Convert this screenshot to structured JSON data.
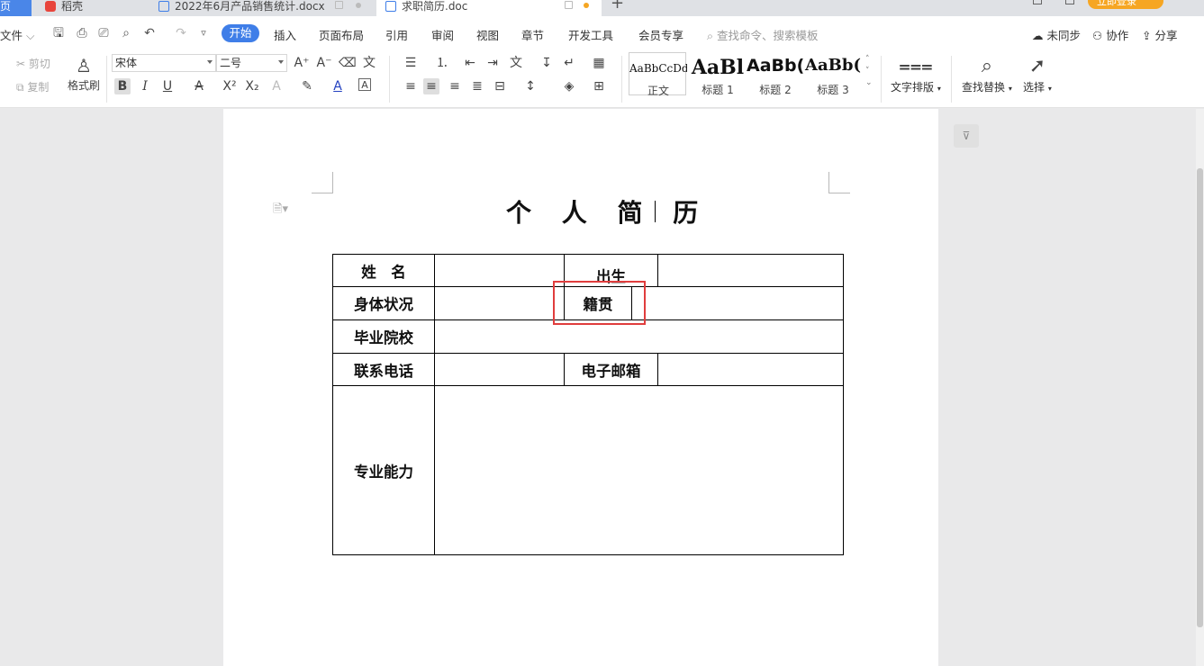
{
  "tabs": {
    "home": "页",
    "daoke": "稻壳",
    "sales_doc": "2022年6月产品销售统计.docx",
    "resume_doc": "求职简历.doc",
    "login": "立即登录"
  },
  "menu": {
    "file": "文件",
    "start": "开始",
    "insert": "插入",
    "layout": "页面布局",
    "references": "引用",
    "review": "审阅",
    "view": "视图",
    "chapter": "章节",
    "devtools": "开发工具",
    "member": "会员专享",
    "search_placeholder": "查找命令、搜索模板",
    "unsynced": "未同步",
    "collab": "协作",
    "share": "分享"
  },
  "ribbon": {
    "cut": "剪切",
    "copy": "复制",
    "format_painter": "格式刷",
    "font_name": "宋体",
    "font_size": "二号",
    "styles": [
      {
        "preview": "AaBbCcDd",
        "label": "正文"
      },
      {
        "preview": "AaBl",
        "label": "标题 1"
      },
      {
        "preview": "AaBb(",
        "label": "标题 2"
      },
      {
        "preview": "AaBb(",
        "label": "标题 3"
      }
    ],
    "text_layout": "文字排版",
    "find_replace": "查找替换",
    "select": "选择"
  },
  "document": {
    "title": "个 人 简 历",
    "table": {
      "name": "姓　名",
      "birth": "出生",
      "health": "身体状况",
      "native": "籍贯",
      "school": "毕业院校",
      "phone": "联系电话",
      "email": "电子邮箱",
      "skills": "专业能力"
    }
  },
  "colors": {
    "accent": "#3f7ee8",
    "highlight": "#e03d3d",
    "login": "#f6a623"
  }
}
